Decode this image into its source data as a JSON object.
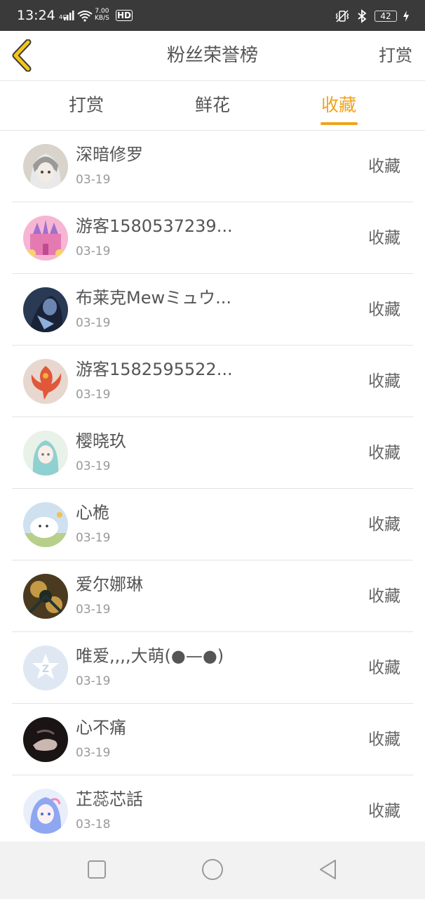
{
  "status_bar": {
    "time": "13:24",
    "network": "4G",
    "speed_value": "7.00",
    "speed_unit": "KB/S",
    "hd": "HD",
    "battery": "42"
  },
  "header": {
    "title": "粉丝荣誉榜",
    "right_action": "打赏",
    "accent_color": "#f0a31c"
  },
  "tabs": [
    {
      "label": "打赏",
      "active": false
    },
    {
      "label": "鲜花",
      "active": false
    },
    {
      "label": "收藏",
      "active": true
    }
  ],
  "fans": [
    {
      "name": "深暗修罗",
      "date": "03-19",
      "action": "收藏",
      "avatar": "anime-girl-gray"
    },
    {
      "name": "游客1580537239...",
      "date": "03-19",
      "action": "收藏",
      "avatar": "pink-castle"
    },
    {
      "name": "布莱克Mewミュウ...",
      "date": "03-19",
      "action": "收藏",
      "avatar": "dark-knight"
    },
    {
      "name": "游客1582595522...",
      "date": "03-19",
      "action": "收藏",
      "avatar": "phoenix"
    },
    {
      "name": "樱晓玖",
      "date": "03-19",
      "action": "收藏",
      "avatar": "anime-girl-teal"
    },
    {
      "name": "心桅",
      "date": "03-19",
      "action": "收藏",
      "avatar": "white-cat"
    },
    {
      "name": "爱尔娜琳",
      "date": "03-19",
      "action": "收藏",
      "avatar": "dark-clover"
    },
    {
      "name": "唯爱,,,,大萌(●—●)",
      "date": "03-19",
      "action": "收藏",
      "avatar": "qq-default"
    },
    {
      "name": "心不痛",
      "date": "03-19",
      "action": "收藏",
      "avatar": "dark-hand"
    },
    {
      "name": "芷蕊芯話",
      "date": "03-18",
      "action": "收藏",
      "avatar": "anime-girl-blue"
    }
  ],
  "nav": {
    "recent": "square-icon",
    "home": "circle-icon",
    "back": "triangle-back-icon"
  }
}
